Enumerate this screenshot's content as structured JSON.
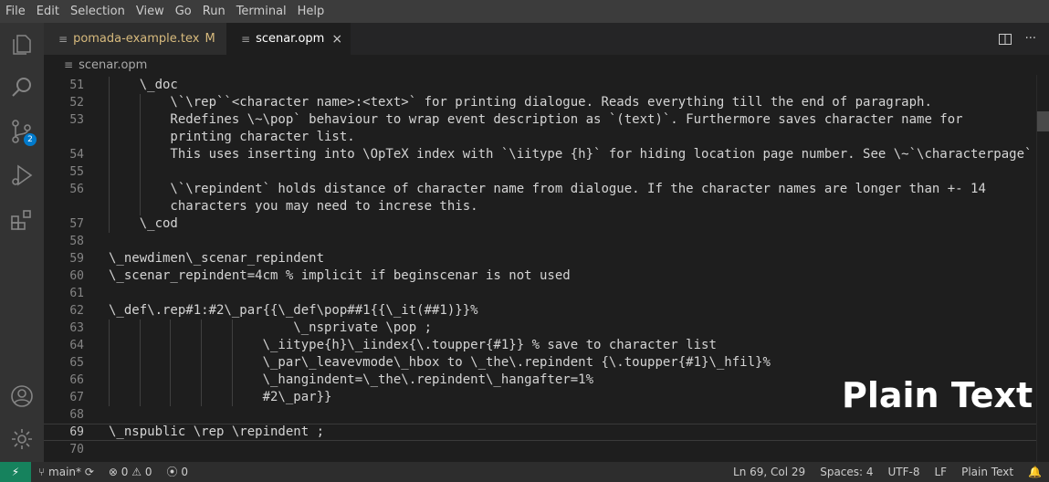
{
  "menu": [
    "File",
    "Edit",
    "Selection",
    "View",
    "Go",
    "Run",
    "Terminal",
    "Help"
  ],
  "activity_bar": {
    "icons": [
      "explorer-icon",
      "search-icon",
      "source-control-icon",
      "run-debug-icon",
      "extensions-icon",
      "account-icon",
      "settings-gear-icon"
    ],
    "scm_badge": "2",
    "colors": {
      "background": "#333333",
      "badge": "#007acc"
    }
  },
  "tabs": [
    {
      "label": "pomada-example.tex",
      "modified": "M",
      "active": false
    },
    {
      "label": "scenar.opm",
      "close": "×",
      "active": true
    }
  ],
  "breadcrumb": {
    "file": "scenar.opm"
  },
  "editor": {
    "lines": [
      {
        "n": "51",
        "text": "    \\_doc"
      },
      {
        "n": "52",
        "text": "        \\`\\rep``<character name>:<text>` for printing dialogue. Reads everything till the end of paragraph."
      },
      {
        "n": "53",
        "text": "        Redefines \\~\\pop` behaviour to wrap event description as `(text)`. Furthermore saves character name for"
      },
      {
        "n": "",
        "text": "        printing character list."
      },
      {
        "n": "54",
        "text": "        This uses inserting into \\OpTeX index with `\\iitype {h}` for hiding location page number. See \\~`\\characterpage`"
      },
      {
        "n": "55",
        "text": ""
      },
      {
        "n": "56",
        "text": "        \\`\\repindent` holds distance of character name from dialogue. If the character names are longer than +- 14"
      },
      {
        "n": "",
        "text": "        characters you may need to increse this."
      },
      {
        "n": "57",
        "text": "    \\_cod"
      },
      {
        "n": "58",
        "text": ""
      },
      {
        "n": "59",
        "text": "\\_newdimen\\_scenar_repindent"
      },
      {
        "n": "60",
        "text": "\\_scenar_repindent=4cm % implicit if beginscenar is not used"
      },
      {
        "n": "61",
        "text": ""
      },
      {
        "n": "62",
        "text": "\\_def\\.rep#1:#2\\_par{{\\_def\\pop##1{{\\_it(##1)}}%"
      },
      {
        "n": "63",
        "text": "                        \\_nsprivate \\pop ;"
      },
      {
        "n": "64",
        "text": "                    \\_iitype{h}\\_iindex{\\.toupper{#1}} % save to character list"
      },
      {
        "n": "65",
        "text": "                    \\_par\\_leavevmode\\_hbox to \\_the\\.repindent {\\.toupper{#1}\\_hfil}%"
      },
      {
        "n": "66",
        "text": "                    \\_hangindent=\\_the\\.repindent\\_hangafter=1%"
      },
      {
        "n": "67",
        "text": "                    #2\\_par}}"
      },
      {
        "n": "68",
        "text": ""
      },
      {
        "n": "69",
        "text": "\\_nspublic \\rep \\repindent ;",
        "current": true
      },
      {
        "n": "70",
        "text": ""
      }
    ],
    "colors": {
      "background": "#1e1e1e",
      "text": "#d4d4d4",
      "line_number": "#858585"
    }
  },
  "overlay_label": "Plain Text",
  "status_bar": {
    "branch": "main*",
    "errors": "0",
    "warnings": "0",
    "ports": "0",
    "position": "Ln 69, Col 29",
    "spaces": "Spaces: 4",
    "encoding": "UTF-8",
    "eol": "LF",
    "language": "Plain Text",
    "colors": {
      "remote": "#16825d",
      "background": "#2d2d2d"
    }
  }
}
